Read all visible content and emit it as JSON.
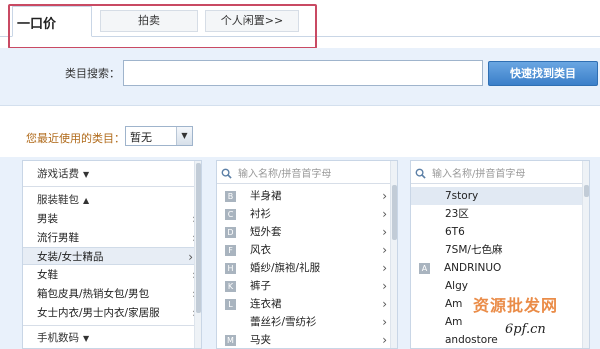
{
  "tabs": {
    "active": "一口价",
    "items": [
      "拍卖",
      "个人闲置>>"
    ]
  },
  "search": {
    "label": "类目搜索：",
    "value": "",
    "button": "快速找到类目"
  },
  "recent": {
    "label": "您最近使用的类目：",
    "selected": "暂无"
  },
  "col1": {
    "items": [
      {
        "label": "游戏话费",
        "type": "group",
        "caret": "down"
      },
      {
        "label": "服装鞋包",
        "type": "group",
        "caret": "up"
      },
      {
        "label": "男装",
        "type": "item"
      },
      {
        "label": "流行男鞋",
        "type": "item"
      },
      {
        "label": "女装/女士精品",
        "type": "item",
        "selected": true
      },
      {
        "label": "女鞋",
        "type": "item"
      },
      {
        "label": "箱包皮具/热销女包/男包",
        "type": "item"
      },
      {
        "label": "女士内衣/男士内衣/家居服",
        "type": "item"
      },
      {
        "label": "手机数码",
        "type": "group",
        "caret": "down"
      }
    ]
  },
  "col2": {
    "search_placeholder": "输入名称/拼音首字母",
    "items": [
      {
        "letter": "B",
        "label": "半身裙"
      },
      {
        "letter": "C",
        "label": "衬衫"
      },
      {
        "letter": "D",
        "label": "短外套"
      },
      {
        "letter": "F",
        "label": "风衣"
      },
      {
        "letter": "H",
        "label": "婚纱/旗袍/礼服"
      },
      {
        "letter": "K",
        "label": "裤子"
      },
      {
        "letter": "L",
        "label": "连衣裙"
      },
      {
        "letter": "",
        "label": "蕾丝衫/雪纺衫"
      },
      {
        "letter": "M",
        "label": "马夹"
      }
    ]
  },
  "col3": {
    "search_placeholder": "输入名称/拼音首字母",
    "items": [
      {
        "letter": "",
        "label": "7story",
        "highlight": true
      },
      {
        "letter": "",
        "label": "23区"
      },
      {
        "letter": "",
        "label": "6T6"
      },
      {
        "letter": "",
        "label": "7SM/七色麻"
      },
      {
        "letter": "A",
        "label": "ANDRINUO"
      },
      {
        "letter": "",
        "label": "Algy"
      },
      {
        "letter": "",
        "label": "Am"
      },
      {
        "letter": "",
        "label": "Am"
      },
      {
        "letter": "",
        "label": "andostore"
      }
    ]
  },
  "watermark": {
    "text": "资源批发网",
    "url": "6pf.cn"
  },
  "colors": {
    "panel_bg": "#e9f1fb",
    "button": "#3b7fc9",
    "highlight_box": "#c94a63",
    "recent_label": "#b06a1a"
  }
}
